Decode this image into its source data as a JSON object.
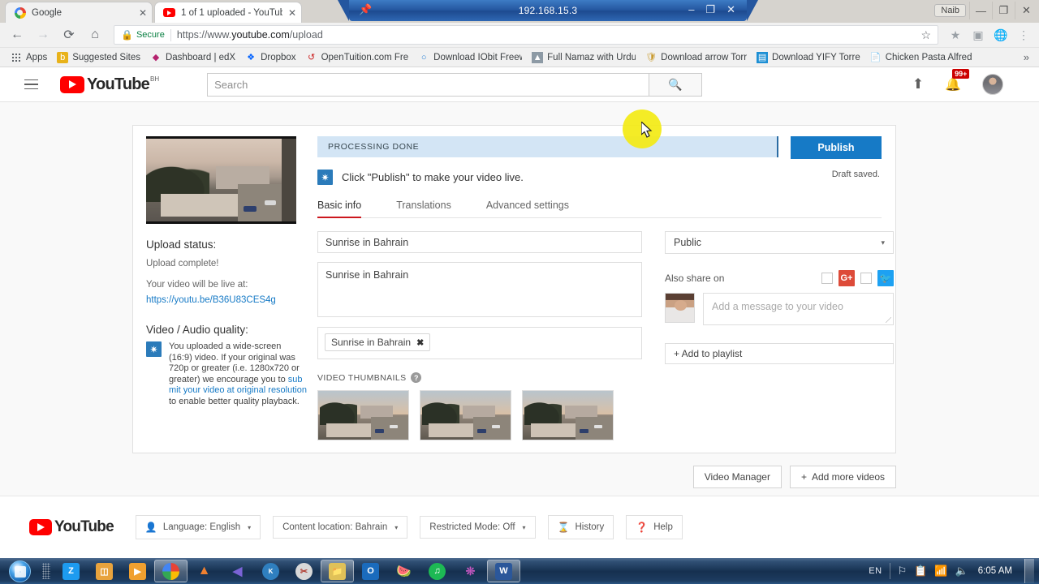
{
  "rdp": {
    "host": "192.168.15.3",
    "pin_icon": "pin-icon",
    "minimize": "–",
    "restore": "❐",
    "close": "✕"
  },
  "browser": {
    "tabs": [
      {
        "title": "Google",
        "favicon": "google-icon",
        "active": false
      },
      {
        "title": "1 of 1 uploaded - YouTub",
        "favicon": "youtube-icon",
        "active": true
      }
    ],
    "profile_name": "Naib",
    "window_buttons": {
      "minimize": "—",
      "restore": "❐",
      "close": "✕"
    },
    "nav": {
      "back": "←",
      "forward": "→",
      "reload": "⟳",
      "home": "⌂"
    },
    "omnibox": {
      "security_label": "Secure",
      "lock_icon": "lock-icon",
      "url_scheme": "https://www.",
      "url_domain": "youtube.com",
      "url_path": "/upload",
      "bookmark_star": "☆"
    },
    "extensions": [
      "star-icon",
      "pdf-icon",
      "globe-icon",
      "menu-icon"
    ],
    "bookmarks": [
      {
        "label": "Apps",
        "icon": "apps-grid-icon"
      },
      {
        "label": "Suggested Sites",
        "icon": "bing-icon"
      },
      {
        "label": "Dashboard | edX",
        "icon": "edx-icon"
      },
      {
        "label": "Dropbox",
        "icon": "dropbox-icon"
      },
      {
        "label": "OpenTuition.com Fre",
        "icon": "opentuition-icon"
      },
      {
        "label": "Download IObit Freew",
        "icon": "iobit-icon"
      },
      {
        "label": "Full Namaz with Urdu",
        "icon": "namaz-icon"
      },
      {
        "label": "Download arrow Torr",
        "icon": "shield-icon"
      },
      {
        "label": "Download YIFY Torre",
        "icon": "film-icon"
      },
      {
        "label": "Chicken Pasta Alfred",
        "icon": "page-icon"
      }
    ],
    "bookmarks_overflow": "»"
  },
  "youtube": {
    "header": {
      "menu_icon": "hamburger-icon",
      "logo_text": "YouTube",
      "country_code": "BH",
      "search_placeholder": "Search",
      "search_icon": "search-icon",
      "upload_icon": "upload-icon",
      "notifications_icon": "bell-icon",
      "notifications_count": "99+",
      "avatar": "account-avatar"
    },
    "status_banner": {
      "processing_text": "PROCESSING DONE",
      "publish_label": "Publish",
      "draft_text": "Draft saved.",
      "hint_text": "Click \"Publish\" to make your video live.",
      "hint_icon": "info-star-icon"
    },
    "tabs": [
      {
        "label": "Basic info",
        "active": true
      },
      {
        "label": "Translations",
        "active": false
      },
      {
        "label": "Advanced settings",
        "active": false
      }
    ],
    "left_panel": {
      "upload_status_title": "Upload status:",
      "upload_status_value": "Upload complete!",
      "live_at_label": "Your video will be live at:",
      "live_url": "https://youtu.be/B36U83CES4g",
      "quality_title": "Video / Audio quality:",
      "quality_icon": "info-star-icon",
      "quality_text_1": "You uploaded a wide-screen (16:9) video. If your original was 720p or greater (i.e. 1280x720 or greater) we encourage you to ",
      "quality_link": "submit your video at original resolution",
      "quality_text_2": " to enable better quality playback.",
      "preview_thumbnail": "video-preview-thumbnail"
    },
    "form": {
      "title_value": "Sunrise in Bahrain",
      "description_value": "Sunrise in Bahrain",
      "tags": [
        {
          "label": "Sunrise in Bahrain",
          "remove": "✖"
        }
      ],
      "thumbnails_label": "VIDEO THUMBNAILS",
      "thumbnails_help": "?",
      "thumbnails": [
        "thumbnail-option-1",
        "thumbnail-option-2",
        "thumbnail-option-3"
      ]
    },
    "sidebar": {
      "privacy_value": "Public",
      "privacy_caret": "▾",
      "also_share_label": "Also share on",
      "gplus_label": "G+",
      "twitter_label": "❦",
      "message_placeholder": "Add a message to your video",
      "channel_avatar": "channel-avatar",
      "playlist_label": "+ Add to playlist"
    },
    "card_actions": [
      {
        "label": "Video Manager",
        "icon": ""
      },
      {
        "label": "Add more videos",
        "icon": "+"
      }
    ],
    "footer": {
      "logo_text": "YouTube",
      "buttons": [
        {
          "label": "Language: English",
          "icon": "person-gear-icon",
          "caret": "▾"
        },
        {
          "label": "Content location: Bahrain",
          "icon": "",
          "caret": "▾"
        },
        {
          "label": "Restricted Mode: Off",
          "icon": "",
          "caret": "▾"
        },
        {
          "label": "History",
          "icon": "hourglass-icon",
          "caret": ""
        },
        {
          "label": "Help",
          "icon": "question-circle-icon",
          "caret": ""
        }
      ]
    }
  },
  "taskbar": {
    "start_icon": "windows-start-orb",
    "items": [
      {
        "name": "zoom-app",
        "glyph": "Z",
        "color": "#1d9bf0",
        "active": false
      },
      {
        "name": "explorer",
        "glyph": "▤",
        "color": "#e8a33d",
        "active": false
      },
      {
        "name": "media-player",
        "glyph": "▶",
        "color": "#f39c12",
        "active": false
      },
      {
        "name": "chrome",
        "glyph": "◉",
        "color": "#4285f4",
        "active": true
      },
      {
        "name": "vlc",
        "glyph": "▲",
        "color": "#e8722a",
        "active": false
      },
      {
        "name": "kmplayer",
        "glyph": "◀",
        "color": "#6f55c8",
        "active": false
      },
      {
        "name": "k-lite",
        "glyph": "●",
        "color": "#3b9ad9",
        "active": false
      },
      {
        "name": "snipping-tool",
        "glyph": "✂",
        "color": "#c0392b",
        "active": false
      },
      {
        "name": "folder-window",
        "glyph": "□",
        "color": "#d9b44a",
        "active": true
      },
      {
        "name": "outlook",
        "glyph": "O",
        "color": "#1a6bbd",
        "active": false
      },
      {
        "name": "fruity-loops",
        "glyph": "♪",
        "color": "#e8713a",
        "active": false
      },
      {
        "name": "spotify",
        "glyph": "♫",
        "color": "#1db954",
        "active": false
      },
      {
        "name": "colors-app",
        "glyph": "◐",
        "color": "#b44ac0",
        "active": false
      },
      {
        "name": "word",
        "glyph": "W",
        "color": "#2b579a",
        "active": true
      }
    ],
    "tray": {
      "language": "EN",
      "icons": [
        "network-error-icon",
        "action-center-icon",
        "signal-icon",
        "volume-icon"
      ],
      "clock": "6:05 AM"
    }
  }
}
